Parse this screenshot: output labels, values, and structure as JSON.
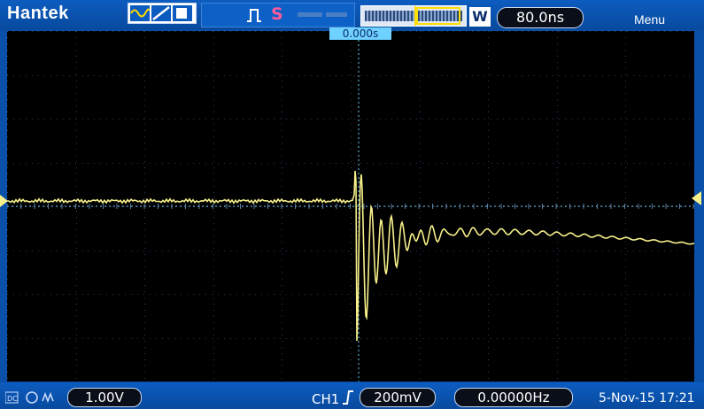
{
  "header": {
    "brand": "Hantek",
    "stop_glyph": "S",
    "wbox": "W",
    "timebase": "80.0ns",
    "menu_label": "Menu"
  },
  "icons": {
    "mode": [
      "sine-wave-icon",
      "ramp-icon",
      "square-icon"
    ],
    "trigger": "trigger-pulse-icon",
    "edge": "rising-edge-icon"
  },
  "screen": {
    "trigger_time": "0.000s"
  },
  "footer": {
    "volts_div": "1.00V",
    "channel": "CH1",
    "trigger_level": "200mV",
    "frequency": "0.00000Hz",
    "datetime": "5-Nov-15 17:21"
  },
  "colors": {
    "frame": "#0a4fa8",
    "trace": "#f7f08a",
    "grid": "#2a3a5a",
    "trigger_line": "#6fd1ff",
    "stop": "#ff5b9a"
  }
}
